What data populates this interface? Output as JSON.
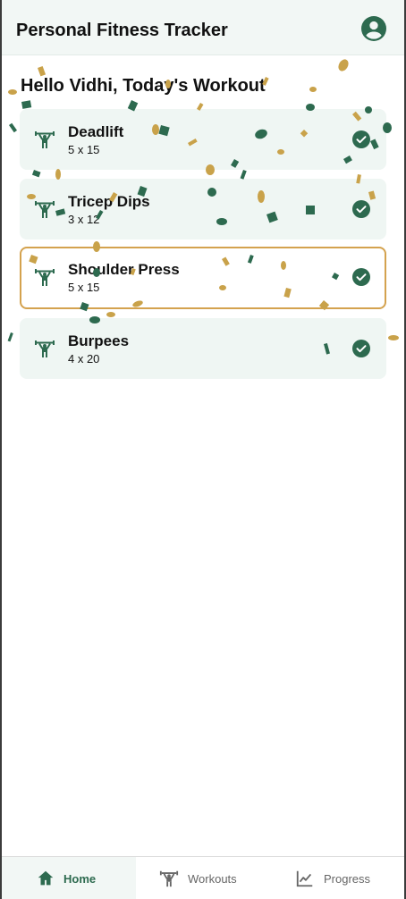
{
  "app": {
    "title": "Personal Fitness Tracker",
    "profile_icon": "account-circle-icon"
  },
  "main": {
    "greeting": "Hello Vidhi, Today's Workout",
    "workouts": [
      {
        "name": "Deadlift",
        "sets": "5 x 15",
        "completed": true,
        "selected": false,
        "icon": "weightlifter-icon"
      },
      {
        "name": "Tricep Dips",
        "sets": "3 x 12",
        "completed": true,
        "selected": false,
        "icon": "weightlifter-icon"
      },
      {
        "name": "Shoulder Press",
        "sets": "5 x 15",
        "completed": true,
        "selected": true,
        "icon": "weightlifter-icon"
      },
      {
        "name": "Burpees",
        "sets": "4 x 20",
        "completed": true,
        "selected": false,
        "icon": "weightlifter-icon"
      }
    ]
  },
  "bottom_nav": {
    "items": [
      {
        "label": "Home",
        "icon": "home-icon",
        "active": true
      },
      {
        "label": "Workouts",
        "icon": "weightlifter-icon",
        "active": false
      },
      {
        "label": "Progress",
        "icon": "line-chart-icon",
        "active": false
      }
    ]
  },
  "colors": {
    "accent": "#2d6a4f",
    "card_bg": "#eff6f3",
    "highlight_border": "#d4a24e",
    "confetti_gold": "#c9a24a",
    "confetti_green": "#2d6a4f"
  }
}
